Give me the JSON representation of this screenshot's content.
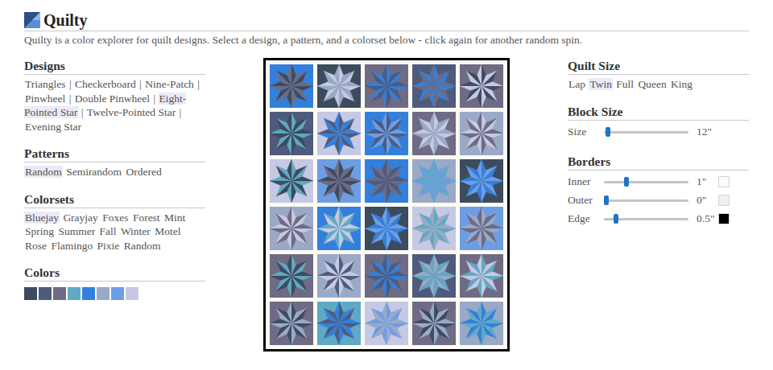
{
  "header": {
    "title": "Quilty",
    "description": "Quilty is a color explorer for quilt designs. Select a design, a pattern, and a colorset below - click again for another random spin."
  },
  "designs": {
    "heading": "Designs",
    "separator": "|",
    "items": [
      {
        "label": "Triangles",
        "selected": false
      },
      {
        "label": "Checkerboard",
        "selected": false
      },
      {
        "label": "Nine-Patch",
        "selected": false
      },
      {
        "label": "Pinwheel",
        "selected": false
      },
      {
        "label": "Double Pinwheel",
        "selected": false
      },
      {
        "label": "Eight-Pointed Star",
        "selected": true
      },
      {
        "label": "Twelve-Pointed Star",
        "selected": false
      },
      {
        "label": "Evening Star",
        "selected": false
      }
    ]
  },
  "patterns": {
    "heading": "Patterns",
    "items": [
      {
        "label": "Random",
        "selected": true
      },
      {
        "label": "Semirandom",
        "selected": false
      },
      {
        "label": "Ordered",
        "selected": false
      }
    ]
  },
  "colorsets": {
    "heading": "Colorsets",
    "items": [
      {
        "label": "Bluejay",
        "selected": true
      },
      {
        "label": "Grayjay",
        "selected": false
      },
      {
        "label": "Foxes",
        "selected": false
      },
      {
        "label": "Forest",
        "selected": false
      },
      {
        "label": "Mint",
        "selected": false
      },
      {
        "label": "Spring",
        "selected": false
      },
      {
        "label": "Summer",
        "selected": false
      },
      {
        "label": "Fall",
        "selected": false
      },
      {
        "label": "Winter",
        "selected": false
      },
      {
        "label": "Motel",
        "selected": false
      },
      {
        "label": "Rose",
        "selected": false
      },
      {
        "label": "Flamingo",
        "selected": false
      },
      {
        "label": "Pixie",
        "selected": false
      },
      {
        "label": "Random",
        "selected": false
      }
    ]
  },
  "colors": {
    "heading": "Colors",
    "items": [
      {
        "color": "#3d4b5e"
      },
      {
        "color": "#4f5b7d"
      },
      {
        "color": "#6f6b84"
      },
      {
        "color": "#5fa9c4"
      },
      {
        "color": "#3380dc"
      },
      {
        "color": "#9aa9c6"
      },
      {
        "color": "#6d9ee4"
      },
      {
        "color": "#c6c9e3"
      }
    ]
  },
  "quilt_size": {
    "heading": "Quilt Size",
    "items": [
      {
        "label": "Lap",
        "selected": false
      },
      {
        "label": "Twin",
        "selected": true
      },
      {
        "label": "Full",
        "selected": false
      },
      {
        "label": "Queen",
        "selected": false
      },
      {
        "label": "King",
        "selected": false
      }
    ]
  },
  "block_size": {
    "heading": "Block Size",
    "label": "Size",
    "level": 0.02,
    "reading": "12\""
  },
  "borders": {
    "heading": "Borders",
    "items": [
      {
        "label": "Inner",
        "level": 0.25,
        "reading": "1\"",
        "color": "#fbfaf4"
      },
      {
        "label": "Outer",
        "level": 0.0,
        "reading": "0\"",
        "color": "#f1f1ec"
      },
      {
        "label": "Edge",
        "level": 0.12,
        "reading": "0.5\"",
        "color": "#000000"
      }
    ]
  },
  "quilt": {
    "rows": [
      [
        {
          "colors": [
            "#3380dc",
            "#3d4b5e",
            "#6f6b84"
          ]
        },
        {
          "colors": [
            "#3d4b5e",
            "#c6c9e3",
            "#9aa9c6"
          ]
        },
        {
          "colors": [
            "#6f6b84",
            "#3380dc",
            "#4f5b7d"
          ]
        },
        {
          "colors": [
            "#4f5b7d",
            "#3380dc",
            "#6f6b84"
          ]
        },
        {
          "colors": [
            "#6f6b84",
            "#3d4b5e",
            "#c6c9e3"
          ]
        }
      ],
      [
        {
          "colors": [
            "#4f5b7d",
            "#5fa9c4",
            "#3d4b5e"
          ]
        },
        {
          "colors": [
            "#c6c9e3",
            "#4f5b7d",
            "#3380dc"
          ]
        },
        {
          "colors": [
            "#3380dc",
            "#4f5b7d",
            "#6d9ee4"
          ]
        },
        {
          "colors": [
            "#6f6b84",
            "#c6c9e3",
            "#9aa9c6"
          ]
        },
        {
          "colors": [
            "#9aa9c6",
            "#c6c9e3",
            "#6f6b84"
          ]
        }
      ],
      [
        {
          "colors": [
            "#c6c9e3",
            "#5fa9c4",
            "#3d4b5e"
          ]
        },
        {
          "colors": [
            "#6d9ee4",
            "#3d4b5e",
            "#6f6b84"
          ]
        },
        {
          "colors": [
            "#3380dc",
            "#6f6b84",
            "#4f5b7d"
          ]
        },
        {
          "colors": [
            "#9aa9c6",
            "#5fa9c4",
            "#6d9ee4"
          ]
        },
        {
          "colors": [
            "#3d4b5e",
            "#3380dc",
            "#6d9ee4"
          ]
        }
      ],
      [
        {
          "colors": [
            "#9aa9c6",
            "#c6c9e3",
            "#6f6b84"
          ]
        },
        {
          "colors": [
            "#3380dc",
            "#5fa9c4",
            "#c6c9e3"
          ]
        },
        {
          "colors": [
            "#3d4b5e",
            "#3380dc",
            "#6d9ee4"
          ]
        },
        {
          "colors": [
            "#c6c9e3",
            "#5fa9c4",
            "#9aa9c6"
          ]
        },
        {
          "colors": [
            "#6d9ee4",
            "#9aa9c6",
            "#6f6b84"
          ]
        }
      ],
      [
        {
          "colors": [
            "#6f6b84",
            "#5fa9c4",
            "#3d4b5e"
          ]
        },
        {
          "colors": [
            "#9aa9c6",
            "#4f5b7d",
            "#c6c9e3"
          ]
        },
        {
          "colors": [
            "#6f6b84",
            "#3380dc",
            "#4f5b7d"
          ]
        },
        {
          "colors": [
            "#4f5b7d",
            "#9aa9c6",
            "#5fa9c4"
          ]
        },
        {
          "colors": [
            "#6f6b84",
            "#5fa9c4",
            "#c6c9e3"
          ]
        }
      ],
      [
        {
          "colors": [
            "#6f6b84",
            "#3d4b5e",
            "#9aa9c6"
          ]
        },
        {
          "colors": [
            "#5fa9c4",
            "#4f5b7d",
            "#3380dc"
          ]
        },
        {
          "colors": [
            "#c6c9e3",
            "#6d9ee4",
            "#9aa9c6"
          ]
        },
        {
          "colors": [
            "#6f6b84",
            "#3d4b5e",
            "#9aa9c6"
          ]
        },
        {
          "colors": [
            "#9aa9c6",
            "#3380dc",
            "#5fa9c4"
          ]
        }
      ]
    ]
  }
}
